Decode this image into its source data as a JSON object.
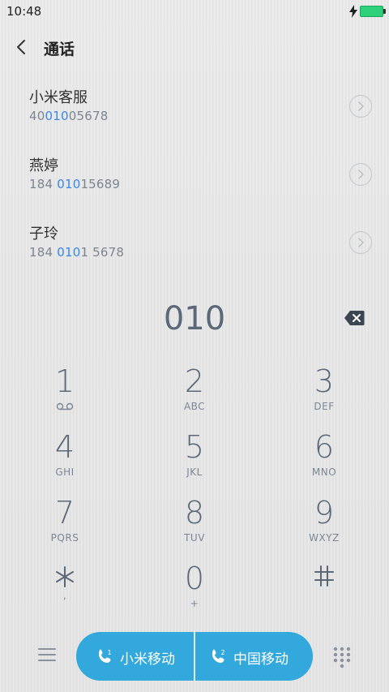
{
  "status_bar": {
    "time": "10:48"
  },
  "header": {
    "title": "通话"
  },
  "contacts": [
    {
      "name": "小米客服",
      "number_pre": "40",
      "number_match": "010",
      "number_post": "05678"
    },
    {
      "name": "燕婷",
      "number_pre": "184 ",
      "number_match": "010",
      "number_post": "15689"
    },
    {
      "name": "子玲",
      "number_pre": "184 ",
      "number_match": "010",
      "number_post": "1 5678"
    }
  ],
  "dial_input": "010",
  "keypad": [
    {
      "digit": "1",
      "letters": ""
    },
    {
      "digit": "2",
      "letters": "ABC"
    },
    {
      "digit": "3",
      "letters": "DEF"
    },
    {
      "digit": "4",
      "letters": "GHI"
    },
    {
      "digit": "5",
      "letters": "JKL"
    },
    {
      "digit": "6",
      "letters": "MNO"
    },
    {
      "digit": "7",
      "letters": "PQRS"
    },
    {
      "digit": "8",
      "letters": "TUV"
    },
    {
      "digit": "9",
      "letters": "WXYZ"
    },
    {
      "digit": "",
      "letters": ","
    },
    {
      "digit": "0",
      "letters": "+"
    },
    {
      "digit": "",
      "letters": ""
    }
  ],
  "call_buttons": [
    {
      "label": "小米移动",
      "sim": "1"
    },
    {
      "label": "中国移动",
      "sim": "2"
    }
  ],
  "colors": {
    "accent": "#32a8dc",
    "highlight": "#3b87e6",
    "battery": "#2fd07a"
  }
}
